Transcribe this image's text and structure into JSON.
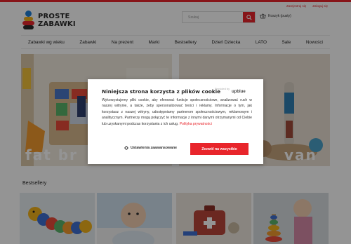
{
  "colors": {
    "brand_red": "#e8252b",
    "logo_blue": "#1e7fd6",
    "logo_yellow": "#f2b21b",
    "dark": "#2a2a2a"
  },
  "top_links": {
    "register": "Zarejestruj się",
    "login": "Zaloguj się"
  },
  "logo": {
    "line1": "PROSTE",
    "line2": "ZABAWKI"
  },
  "search": {
    "placeholder": "Szukaj",
    "button_icon": "search-icon"
  },
  "cart": {
    "label": "Koszyk (pusty)",
    "icon": "basket-icon"
  },
  "nav": {
    "items": [
      "Zabawki wg wieku",
      "Zabawki",
      "Na prezent",
      "Marki",
      "Bestsellery",
      "Dzień Dziecka",
      "LATO",
      "Sale",
      "Nowości"
    ]
  },
  "hero": {
    "left_word": "fat br",
    "right_word": "van"
  },
  "bestsellers": {
    "title": "Bestsellery"
  },
  "consent": {
    "title": "Niniejsza strona korzysta z plików cookie",
    "provided_by": "Provided by",
    "brand": "upblue",
    "body": "Wykorzystujemy pliki cookie, aby oferować funkcje społecznościowe, analizować ruch w naszej witrynie, a także, żeby spersonalizować treści i reklamy. Informacje o tym, jak korzystasz z naszej witryny, udostępniamy partnerom społecznościowym, reklamowym i analitycznym. Partnerzy mogą połączyć te informacje z innymi danymi otrzymanymi od Ciebie lub uzyskanymi podczas korzystania z ich usług.",
    "privacy_link": "Polityka prywatności",
    "settings_button": "Ustawienia zaawansowane",
    "accept_button": "Zezwól na wszystkie"
  }
}
